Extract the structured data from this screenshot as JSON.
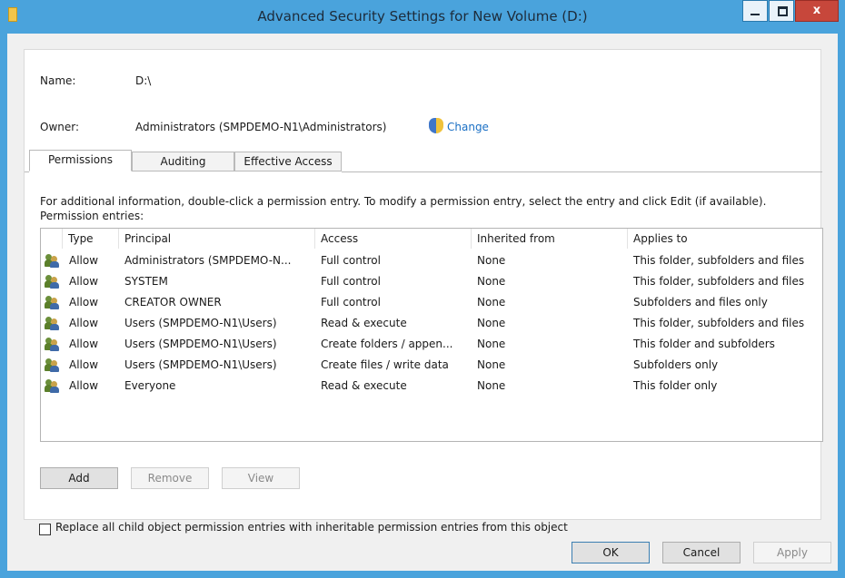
{
  "window": {
    "title": "Advanced Security Settings for New Volume (D:)",
    "accent": "#4aa3dc"
  },
  "info": {
    "name_label": "Name:",
    "name_value": "D:\\",
    "owner_label": "Owner:",
    "owner_value": "Administrators (SMPDEMO-N1\\Administrators)",
    "change_link": "Change"
  },
  "tabs": [
    {
      "label": "Permissions",
      "active": true
    },
    {
      "label": "Auditing",
      "active": false
    },
    {
      "label": "Effective Access",
      "active": false
    }
  ],
  "description": "For additional information, double-click a permission entry. To modify a permission entry, select the entry and click Edit (if available).",
  "entries_label": "Permission entries:",
  "columns": [
    "Type",
    "Principal",
    "Access",
    "Inherited from",
    "Applies to"
  ],
  "rows": [
    {
      "type": "Allow",
      "principal": "Administrators (SMPDEMO-N...",
      "access": "Full control",
      "inherited": "None",
      "applies": "This folder, subfolders and files"
    },
    {
      "type": "Allow",
      "principal": "SYSTEM",
      "access": "Full control",
      "inherited": "None",
      "applies": "This folder, subfolders and files"
    },
    {
      "type": "Allow",
      "principal": "CREATOR OWNER",
      "access": "Full control",
      "inherited": "None",
      "applies": "Subfolders and files only"
    },
    {
      "type": "Allow",
      "principal": "Users (SMPDEMO-N1\\Users)",
      "access": "Read & execute",
      "inherited": "None",
      "applies": "This folder, subfolders and files"
    },
    {
      "type": "Allow",
      "principal": "Users (SMPDEMO-N1\\Users)",
      "access": "Create folders / appen...",
      "inherited": "None",
      "applies": "This folder and subfolders"
    },
    {
      "type": "Allow",
      "principal": "Users (SMPDEMO-N1\\Users)",
      "access": "Create files / write data",
      "inherited": "None",
      "applies": "Subfolders only"
    },
    {
      "type": "Allow",
      "principal": "Everyone",
      "access": "Read & execute",
      "inherited": "None",
      "applies": "This folder only"
    }
  ],
  "actions": {
    "add": "Add",
    "remove": "Remove",
    "view": "View"
  },
  "replace_checkbox_label": "Replace all child object permission entries with inheritable permission entries from this object",
  "footer": {
    "ok": "OK",
    "cancel": "Cancel",
    "apply": "Apply"
  }
}
